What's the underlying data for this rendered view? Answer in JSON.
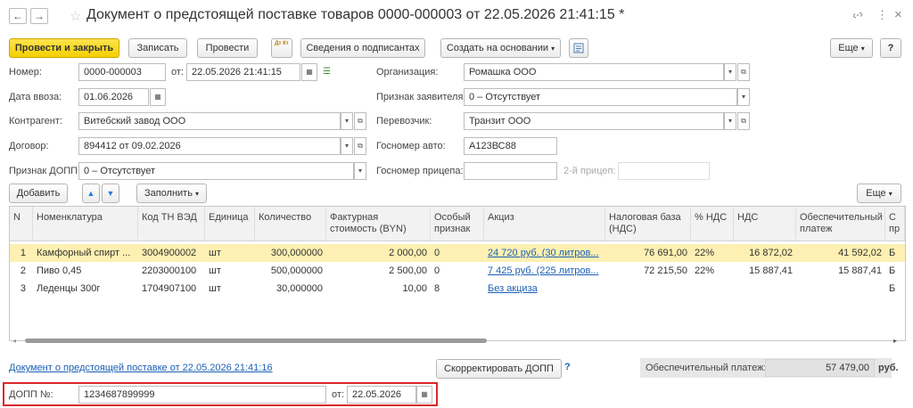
{
  "window": {
    "title": "Документ о предстоящей поставке товаров 0000-000003 от 22.05.2026 21:41:15 *",
    "back_icon": "←",
    "forward_icon": "→",
    "star_icon": "☆",
    "link_icon": "🔗",
    "menu_icon": "⋮",
    "close_icon": "×"
  },
  "toolbar": {
    "post_close": "Провести и закрыть",
    "write": "Записать",
    "post": "Провести",
    "dtkt": "Дт Кт",
    "signers": "Сведения о подписантах",
    "create_based": "Создать на основании",
    "more": "Еще",
    "help": "?"
  },
  "form": {
    "number_label": "Номер:",
    "number_value": "0000-000003",
    "from_label": "от:",
    "date_value": "22.05.2026 21:41:15",
    "import_date_label": "Дата ввоза:",
    "import_date_value": "01.06.2026",
    "contractor_label": "Контрагент:",
    "contractor_value": "Витебский завод ООО",
    "contract_label": "Договор:",
    "contract_value": "894412 от 09.02.2026",
    "dopp_sign_label": "Признак ДОПП:",
    "dopp_sign_value": "0 – Отсутствует",
    "org_label": "Организация:",
    "org_value": "Ромашка ООО",
    "applicant_label": "Признак заявителя:",
    "applicant_value": "0 – Отсутствует",
    "carrier_label": "Перевозчик:",
    "carrier_value": "Транзит ООО",
    "car_number_label": "Госномер авто:",
    "car_number_value": "А123ВС88",
    "trailer_label": "Госномер прицепа:",
    "trailer_value": "",
    "trailer2_label": "2-й прицеп:",
    "trailer2_value": ""
  },
  "table_toolbar": {
    "add": "Добавить",
    "up": "▲",
    "down": "▼",
    "fill": "Заполнить",
    "more": "Еще"
  },
  "table": {
    "headers": [
      "N",
      "Номенклатура",
      "Код ТН ВЭД",
      "Единица",
      "Количество",
      "Фактурная стоимость (BYN)",
      "Особый признак",
      "Акциз",
      "Налоговая база (НДС)",
      "% НДС",
      "НДС",
      "Обеспечительный платеж",
      "С пр"
    ],
    "rows": [
      [
        "1",
        "Камфорный спирт ...",
        "3004900002",
        "шт",
        "300,000000",
        "2 000,00",
        "0",
        "24 720 руб. (30 литров...",
        "76 691,00",
        "22%",
        "16 872,02",
        "41 592,02",
        "Б"
      ],
      [
        "2",
        "Пиво 0,45",
        "2203000100",
        "шт",
        "500,000000",
        "2 500,00",
        "0",
        "7 425 руб. (225 литров...",
        "72 215,50",
        "22%",
        "15 887,41",
        "15 887,41",
        "Б"
      ],
      [
        "3",
        "Леденцы 300г",
        "1704907100",
        "шт",
        "30,000000",
        "10,00",
        "8",
        "Без акциза",
        "",
        "",
        "",
        "",
        "Б"
      ]
    ]
  },
  "footer": {
    "doc_link": "Документ о предстоящей поставке от 22.05.2026 21:41:16",
    "adjust_button": "Скорректировать ДОПП",
    "help": "?",
    "guarantee_label": "Обеспечительный платеж:",
    "guarantee_value": "57 479,00",
    "currency": "руб."
  },
  "dopp": {
    "label": "ДОПП №:",
    "number": "1234687899999",
    "from_label": "от:",
    "date": "22.05.2026"
  },
  "colors": {
    "accent": "#f5cf00",
    "highlight_row": "#fdf0b2",
    "alert_border": "#d9292b",
    "link": "#1a5fb4"
  }
}
